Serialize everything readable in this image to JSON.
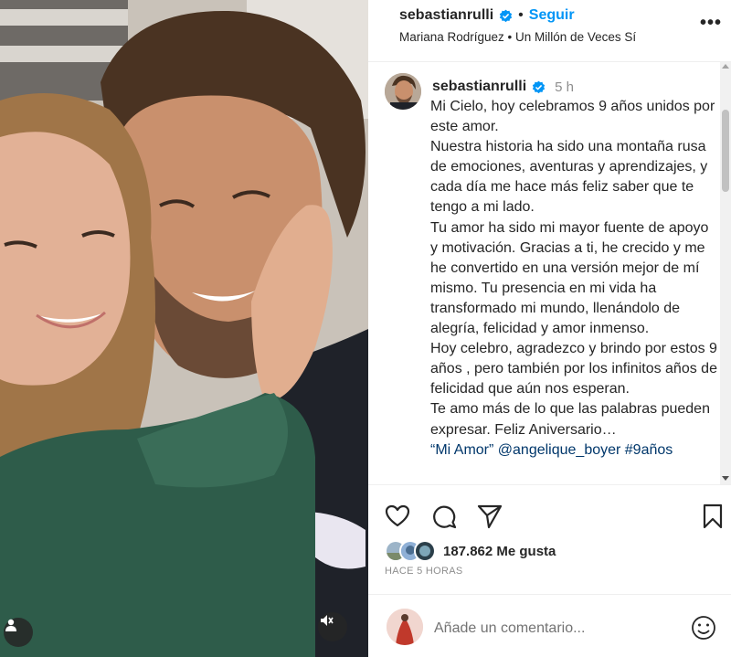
{
  "header": {
    "username": "sebastianrulli",
    "separator": "•",
    "follow_label": "Seguir",
    "audio": "Mariana Rodríguez • Un Millón de Veces Sí",
    "more_label": "•••"
  },
  "caption": {
    "username": "sebastianrulli",
    "time": "5 h",
    "paragraphs": [
      "Mi Cielo, hoy celebramos 9 años unidos por este amor.",
      "Nuestra historia ha sido una montaña rusa de emociones, aventuras y aprendizajes, y cada día me hace más feliz saber que te tengo a mi lado.",
      "Tu amor ha sido mi mayor fuente de apoyo y motivación. Gracias a ti, he crecido y me he convertido en una versión mejor de mí mismo. Tu presencia en mi vida ha transformado mi mundo, llenándolo de alegría, felicidad y amor inmenso.",
      "Hoy celebro, agradezco y brindo por estos 9 años , pero también por los infinitos años de felicidad que aún nos esperan.",
      "Te amo más de lo que las palabras pueden expresar. Feliz Aniversario…",
      "“Mi Amor” @angelique_boyer #9años"
    ]
  },
  "stats": {
    "likes": "187.862 Me gusta",
    "time_ago": "HACE 5 HORAS"
  },
  "comment": {
    "placeholder": "Añade un comentario..."
  },
  "icons": {
    "like": "heart-icon",
    "comment": "comment-icon",
    "share": "share-icon",
    "save": "bookmark-icon",
    "emoji": "emoji-icon",
    "verified": "verified-badge-icon",
    "tagged_user": "user-tag-icon",
    "mute": "mute-icon"
  },
  "colors": {
    "accent": "#0095f6",
    "verified": "#0095f6",
    "text": "#262626",
    "muted": "#8e8e8e"
  }
}
